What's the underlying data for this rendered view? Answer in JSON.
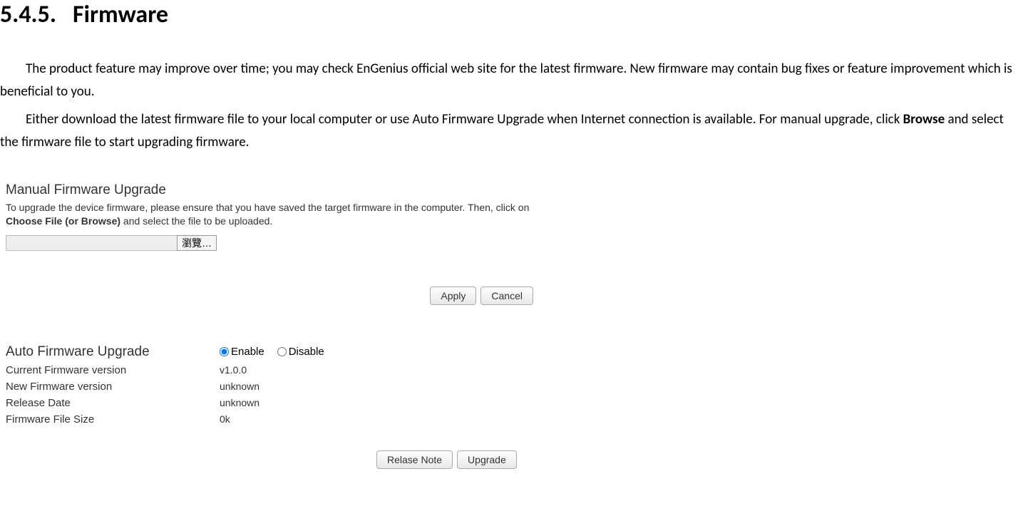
{
  "heading": {
    "number": "5.4.5.",
    "title": "Firmware"
  },
  "paragraphs": {
    "p1": "The product feature may improve over time; you may check EnGenius official web site for the latest firmware. New firmware may contain bug fixes or feature improvement which is beneficial to you.",
    "p2_before": "Either download the latest firmware file to your local computer or use Auto Firmware Upgrade when Internet connection is available. For manual upgrade, click ",
    "p2_bold": "Browse",
    "p2_after": " and select the firmware file to start upgrading firmware."
  },
  "manual_panel": {
    "title": "Manual Firmware Upgrade",
    "desc_before": "To upgrade the device firmware, please ensure that you have saved the target firmware in the computer. Then, click on ",
    "desc_bold": "Choose File (or Browse)",
    "desc_after": " and select the file to be uploaded.",
    "browse_button": "瀏覽…",
    "apply_button": "Apply",
    "cancel_button": "Cancel"
  },
  "auto_panel": {
    "title": "Auto Firmware Upgrade",
    "enable_label": "Enable",
    "disable_label": "Disable",
    "rows": [
      {
        "label": "Current Firmware version",
        "value": "v1.0.0"
      },
      {
        "label": "New Firmware version",
        "value": "unknown"
      },
      {
        "label": "Release Date",
        "value": "unknown"
      },
      {
        "label": "Firmware File Size",
        "value": "0k"
      }
    ],
    "release_note_button": "Relase Note",
    "upgrade_button": "Upgrade"
  }
}
